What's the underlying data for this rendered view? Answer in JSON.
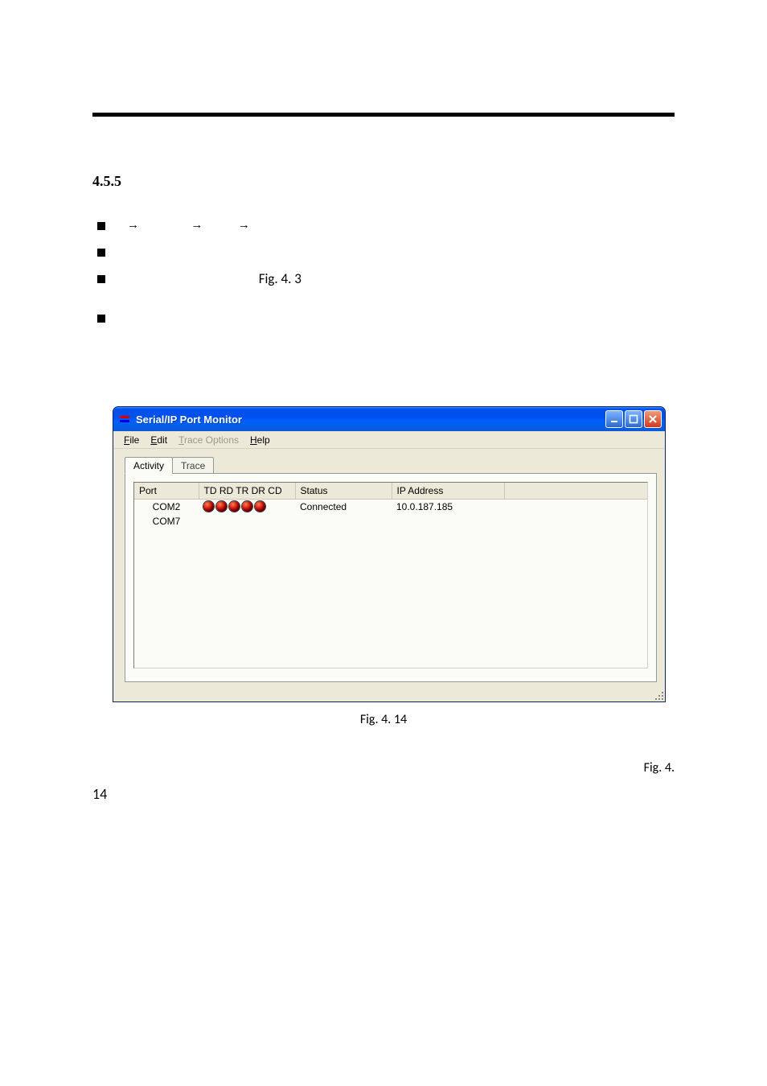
{
  "section_number": "4.5.5",
  "bullets": {
    "b1_arrow": "→",
    "b3_prefix_label": "Fig. 4. 3"
  },
  "window": {
    "title": "Serial/IP Port Monitor",
    "menus": {
      "file": "File",
      "edit": "Edit",
      "trace": "Trace Options",
      "help": "Help"
    },
    "tabs": {
      "activity": "Activity",
      "trace": "Trace"
    },
    "columns": {
      "port": "Port",
      "signals": "TD RD TR DR CD",
      "status": "Status",
      "ip": "IP Address"
    },
    "rows": [
      {
        "port": "COM2",
        "status": "Connected",
        "ip": "10.0.187.185"
      },
      {
        "port": "COM7",
        "status": "",
        "ip": ""
      }
    ]
  },
  "captions": {
    "fig414": "Fig. 4. 14",
    "figref_inline": "Fig. 4.",
    "fig14_num": "14"
  }
}
